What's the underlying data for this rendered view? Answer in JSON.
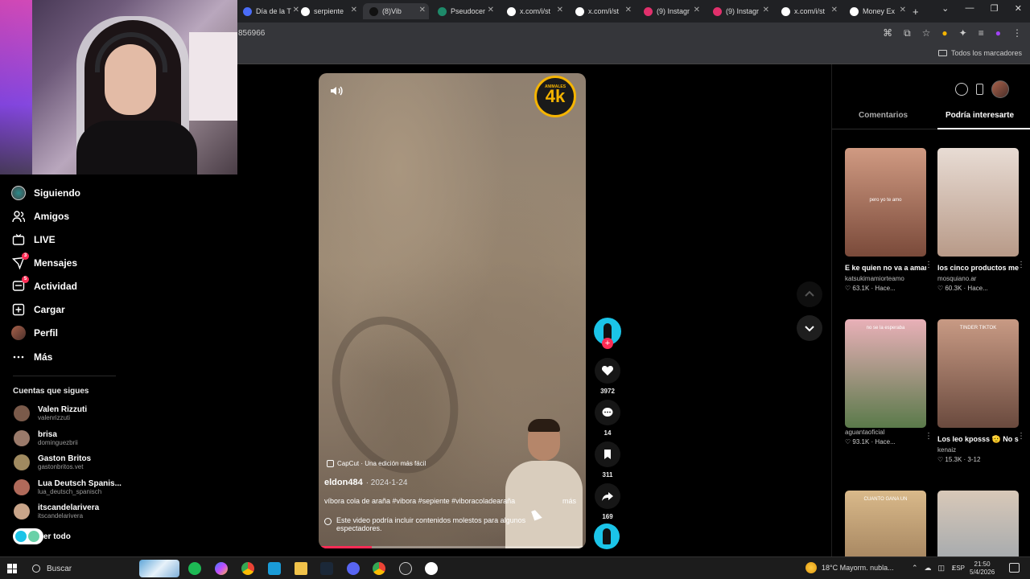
{
  "browser": {
    "tabs": [
      {
        "title": "Día de la T",
        "favicon_color": "#4a6cf7",
        "active": false
      },
      {
        "title": "serpiente",
        "favicon_color": "#ffffff",
        "active": false
      },
      {
        "title": "(8)Vib",
        "favicon_color": "#111111",
        "active": true
      },
      {
        "title": "Pseudocer",
        "favicon_color": "#1e8a6a",
        "active": false
      },
      {
        "title": "x.com/i/st",
        "favicon_color": "#ffffff",
        "active": false
      },
      {
        "title": "x.com/i/st",
        "favicon_color": "#ffffff",
        "active": false
      },
      {
        "title": "(9) Instagr",
        "favicon_color": "#e1306c",
        "active": false
      },
      {
        "title": "(9) Instagr",
        "favicon_color": "#e1306c",
        "active": false
      },
      {
        "title": "x.com/i/st",
        "favicon_color": "#ffffff",
        "active": false
      },
      {
        "title": "Money Ex",
        "favicon_color": "#ffffff",
        "active": false
      }
    ],
    "new_tab": "+",
    "url": "856966",
    "bookmarks_all": "Todos los marcadores"
  },
  "sidebar": {
    "nav": [
      {
        "label": "Siguiendo",
        "icon": "following-avatar-icon",
        "badge": ""
      },
      {
        "label": "Amigos",
        "icon": "friends-icon",
        "badge": ""
      },
      {
        "label": "LIVE",
        "icon": "live-icon",
        "badge": ""
      },
      {
        "label": "Mensajes",
        "icon": "messages-icon",
        "badge": "3"
      },
      {
        "label": "Actividad",
        "icon": "activity-icon",
        "badge": "5"
      },
      {
        "label": "Cargar",
        "icon": "upload-icon",
        "badge": ""
      },
      {
        "label": "Perfil",
        "icon": "profile-avatar-icon",
        "badge": ""
      },
      {
        "label": "Más",
        "icon": "more-icon",
        "badge": ""
      }
    ],
    "following_title": "Cuentas que sigues",
    "accounts": [
      {
        "name": "Valen Rizzuti",
        "handle": "valenrizzuti",
        "color": "#7a5a4a"
      },
      {
        "name": "brisa",
        "handle": "dominguezbrii",
        "color": "#9a7a6a"
      },
      {
        "name": "Gaston Britos",
        "handle": "gastonbritos.vet",
        "color": "#a08a60"
      },
      {
        "name": "Lua Deutsch Spanis...",
        "handle": "lua_deutsch_spanisch",
        "color": "#b06a5a"
      },
      {
        "name": "itscandelarivera",
        "handle": "itscandelarivera",
        "color": "#c9a58a"
      }
    ],
    "see_all": "er todo"
  },
  "video": {
    "watermark": "4k",
    "watermark_small": "ANIMALES",
    "capcut": "CapCut · Una edición más fácil",
    "author": "eldon484",
    "date": "· 2024-1-24",
    "description": "víbora cola de araña #vibora #sepiente #viboracoladearaña",
    "more": "más",
    "warning": "Este video podría incluir contenidos molestos para algunos espectadores.",
    "progress": 0.2
  },
  "actions": {
    "likes": "3972",
    "comments": "14",
    "saves": "311",
    "shares": "169"
  },
  "right_panel": {
    "tab_comments": "Comentarios",
    "tab_interest": "Podría interesarte",
    "cards": [
      {
        "title": "E ke quien no va a amar al Duko 🥀 ...",
        "user": "katsukimamiorteamo",
        "likes": "63.1K",
        "time": "Hace...",
        "caption": "pero yo te amo",
        "color1": "#d09a82",
        "color2": "#7a4a3a"
      },
      {
        "title": "los cinco productos meno...",
        "user": "mosquiano.ar",
        "likes": "60.3K",
        "time": "Hace...",
        "caption": "",
        "color1": "#e8dcd4",
        "color2": "#b89a88"
      },
      {
        "title": "",
        "user": "aguantaoficial",
        "likes": "93.1K",
        "time": "Hace...",
        "caption": "no se la esperaba",
        "color1": "#e9b0b8",
        "color2": "#5a7a4a"
      },
      {
        "title": "Los leo kposss 🫡 No sean tibios ...",
        "user": "kenaiz",
        "likes": "15.3K",
        "time": "3-12",
        "caption": "TINDER TIKTOK",
        "color1": "#c89a84",
        "color2": "#6a4a3e"
      },
      {
        "title": "",
        "user": "",
        "likes": "",
        "time": "",
        "caption": "CUANTO GANA UN",
        "color1": "#d9b98a",
        "color2": "#8a6a4a"
      },
      {
        "title": "",
        "user": "",
        "likes": "",
        "time": "",
        "caption": "",
        "color1": "#d8c8b8",
        "color2": "#8a9aa8"
      }
    ]
  },
  "taskbar": {
    "search": "Buscar",
    "weather": "18°C  Mayorm. nubla...",
    "lang": "ESP",
    "time": "21:50",
    "date": "5/4/2026"
  }
}
